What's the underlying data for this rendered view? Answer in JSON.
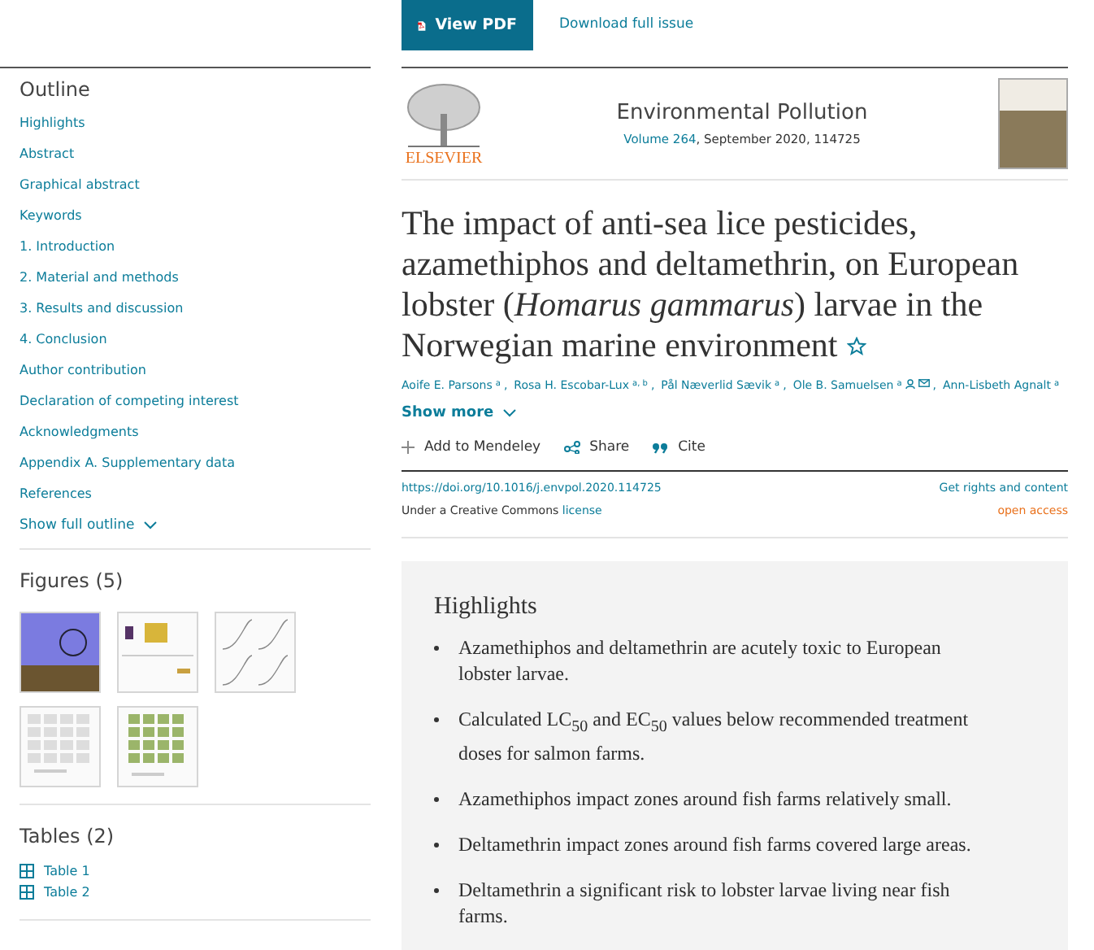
{
  "toolbar": {
    "pdf_button": "View PDF",
    "download_link": "Download full issue"
  },
  "sidebar": {
    "outline": {
      "title": "Outline",
      "items": [
        {
          "label": "Highlights"
        },
        {
          "label": "Abstract"
        },
        {
          "label": "Graphical abstract"
        },
        {
          "label": "Keywords"
        },
        {
          "label": "1. Introduction"
        },
        {
          "label": "2. Material and methods"
        },
        {
          "label": "3. Results and discussion"
        },
        {
          "label": "4. Conclusion"
        },
        {
          "label": "Author contribution"
        },
        {
          "label": "Declaration of competing interest"
        },
        {
          "label": "Acknowledgments"
        },
        {
          "label": "Appendix A. Supplementary data"
        },
        {
          "label": "References"
        }
      ],
      "show_more": "Show full outline"
    },
    "figures": {
      "title": "Figures (5)",
      "items": [
        {
          "kind": "map"
        },
        {
          "kind": "panels"
        },
        {
          "kind": "curves"
        },
        {
          "kind": "grid"
        },
        {
          "kind": "photos"
        }
      ]
    },
    "tables": {
      "title": "Tables (2)",
      "items": [
        {
          "label": "Table 1"
        },
        {
          "label": "Table 2"
        }
      ]
    }
  },
  "journal": {
    "publisher": "ELSEVIER",
    "name": "Environmental Pollution",
    "volume_link": "Volume 264",
    "issue_info": ", September 2020, 114725"
  },
  "article": {
    "title": "The impact of anti-sea lice pesticides, azamethiphos and deltamethrin, on European lobster (*Homarus gammarus*) larvae in the Norwegian marine environment",
    "authors": [
      {
        "name": "Aoife E. Parsons",
        "sup": "a",
        "corresponding": false,
        "separator": ","
      },
      {
        "name": "Rosa H. Escobar-Lux",
        "sup": "a, b",
        "corresponding": false,
        "separator": ","
      },
      {
        "name": "Pål Næverlid Sævik",
        "sup": "a",
        "corresponding": false,
        "separator": ","
      },
      {
        "name": "Ole B. Samuelsen",
        "sup": "a",
        "corresponding": true,
        "separator": ","
      },
      {
        "name": "Ann-Lisbeth Agnalt",
        "sup": "a",
        "corresponding": false
      }
    ],
    "show_more": "Show more",
    "actions": [
      {
        "kind": "add",
        "label": "Add to Mendeley"
      },
      {
        "kind": "share",
        "label": "Share"
      },
      {
        "kind": "cite",
        "label": "Cite"
      }
    ],
    "doi": "https://doi.org/10.1016/j.envpol.2020.114725",
    "rights": "Get rights and content",
    "license_text": "Under a Creative Commons",
    "license_link": "license",
    "access": "open access"
  },
  "highlights": {
    "title": "Highlights",
    "items": [
      "Azamethiphos and deltamethrin are acutely toxic to European lobster larvae.",
      "Calculated LC$_{50}$ and EC$_{50}$ values below recommended treatment doses for salmon farms.",
      "Azamethiphos impact zones around fish farms relatively small.",
      "Deltamethrin impact zones around fish farms covered large areas.",
      "Deltamethrin a significant risk to lobster larvae living near fish farms."
    ]
  }
}
